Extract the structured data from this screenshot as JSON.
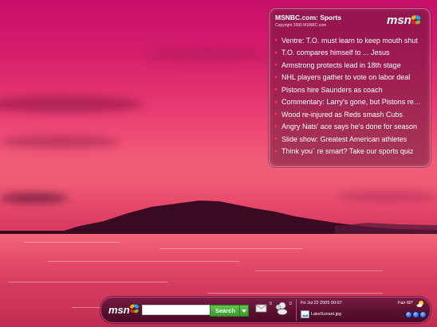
{
  "gadget": {
    "title": "MSNBC.com: Sports",
    "copyright": "Copyright 2005 MSNBC.com",
    "logo_text": "msn",
    "headlines": [
      "Ventre: T.O. must learn to keep mouth shut",
      "T.O. compares himself to ... Jesus",
      "Armstrong protects lead in 18th stage",
      "NHL players gather to vote on labor deal",
      "Pistons hire Saunders as coach",
      "Commentary: Larry's gone, but Pistons remain",
      "Wood re-injured as Reds smash Cubs",
      "Angry Nats' ace says he's done for season",
      "Slide show: Greatest American athletes",
      "Think you´ re smart? Take our sports quiz"
    ]
  },
  "taskbar": {
    "logo_text": "msn",
    "search_value": "",
    "search_label": "Search",
    "mail_count": "0",
    "messenger_count": "0",
    "datetime": "Fri Jul 22 2005 00:07",
    "weather": "Fair 60°",
    "wallpaper_name": "LakeSunset.jpg"
  },
  "colors": {
    "accent_green": "#3a9c2e",
    "bullet_red": "#ff3050",
    "taskbar_bg": "#5a0f30"
  },
  "icons": {
    "taskbar_logo": "msn-butterfly-icon",
    "mail": "mail-icon",
    "messenger": "messenger-buddy-icon",
    "weather": "partly-cloudy-icon",
    "wallpaper": "picture-icon"
  }
}
